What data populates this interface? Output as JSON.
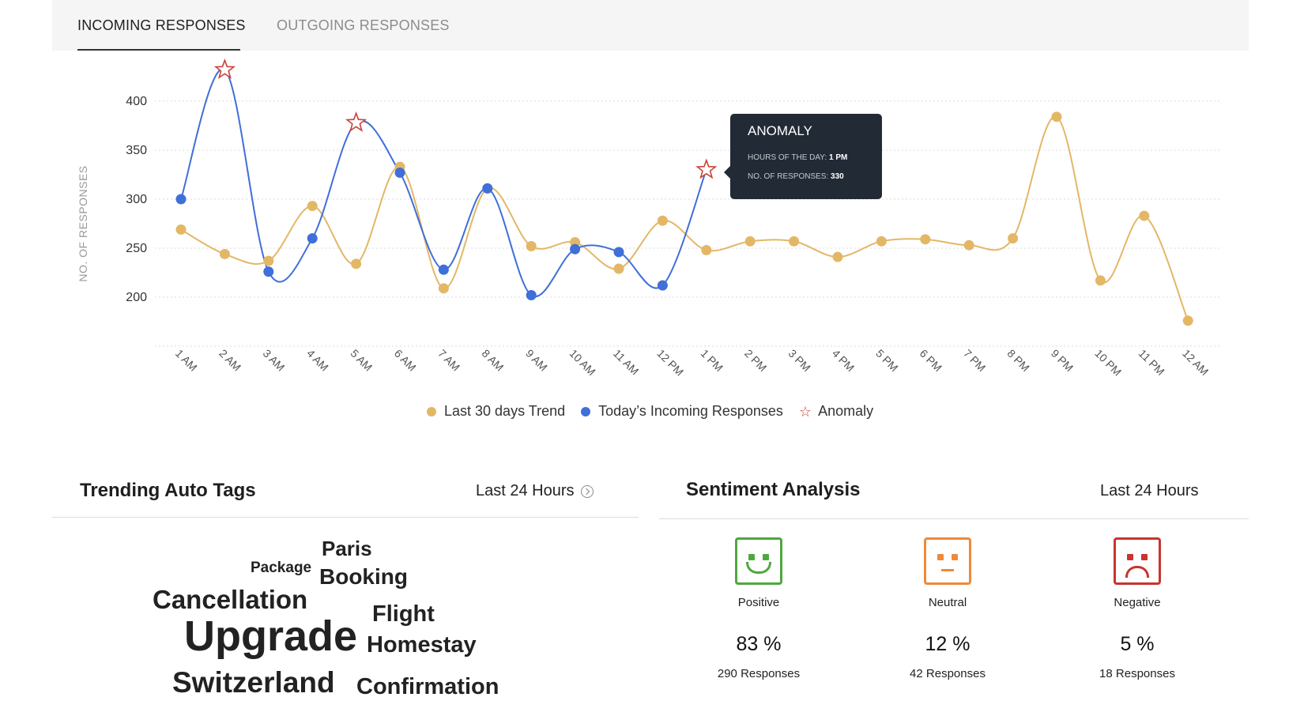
{
  "tabs": [
    {
      "label": "INCOMING RESPONSES",
      "active": true
    },
    {
      "label": "OUTGOING RESPONSES",
      "active": false
    }
  ],
  "chart_data": {
    "type": "line",
    "ylabel": "NO. OF RESPONSES",
    "ylim": [
      150,
      420
    ],
    "yticks": [
      200,
      250,
      300,
      350,
      400
    ],
    "categories": [
      "1 AM",
      "2 AM",
      "3 AM",
      "4 AM",
      "5 AM",
      "6 AM",
      "7 AM",
      "8 AM",
      "9 AM",
      "10 AM",
      "11 AM",
      "12 PM",
      "1 PM",
      "2 PM",
      "3 PM",
      "4 PM",
      "5 PM",
      "6 PM",
      "7 PM",
      "8 PM",
      "9 PM",
      "10 PM",
      "11 PM",
      "12 AM"
    ],
    "series": [
      {
        "name": "Last 30 days Trend",
        "color": "#e3b766",
        "values": [
          269,
          244,
          237,
          293,
          234,
          333,
          209,
          311,
          252,
          256,
          229,
          278,
          248,
          257,
          257,
          241,
          257,
          259,
          253,
          260,
          384,
          217,
          283,
          176
        ]
      },
      {
        "name": "Today’s Incoming Responses",
        "color": "#3f6fd8",
        "values": [
          300,
          432,
          226,
          260,
          378,
          327,
          228,
          311,
          202,
          249,
          246,
          212,
          330
        ]
      }
    ],
    "anomalies": [
      {
        "category": "2 AM",
        "value": 432
      },
      {
        "category": "5 AM",
        "value": 378
      },
      {
        "category": "1 PM",
        "value": 330
      }
    ],
    "anomaly_legend": "Anomaly",
    "tooltip": {
      "title": "ANOMALY",
      "hour_label": "HOURS OF THE DAY:",
      "hour_value": "1 PM",
      "count_label": "NO. OF RESPONSES:",
      "count_value": "330"
    },
    "grid": true,
    "legend_position": "bottom"
  },
  "tags_panel": {
    "title": "Trending Auto Tags",
    "period": "Last 24 Hours",
    "tags": [
      {
        "text": "Paris",
        "color": "#a8d07a"
      },
      {
        "text": "Package",
        "color": "#e06c8c"
      },
      {
        "text": "Booking",
        "color": "#a9b865"
      },
      {
        "text": "Cancellation",
        "color": "#79a7ee"
      },
      {
        "text": "Flight",
        "color": "#e0575a"
      },
      {
        "text": "Upgrade",
        "color": "#6fcfae"
      },
      {
        "text": "Homestay",
        "color": "#e89466"
      },
      {
        "text": "Switzerland",
        "color": "#a468dc"
      },
      {
        "text": "Confirmation",
        "color": "#ecc56a"
      }
    ]
  },
  "sentiment_panel": {
    "title": "Sentiment Analysis",
    "period": "Last 24 Hours",
    "items": [
      {
        "label": "Positive",
        "percent": "83 %",
        "count": "290 Responses",
        "color": "#4ea83f",
        "icon": "smiley-face-icon"
      },
      {
        "label": "Neutral",
        "percent": "12 %",
        "count": "42 Responses",
        "color": "#ee8a3a",
        "icon": "neutral-face-icon"
      },
      {
        "label": "Negative",
        "percent": "5 %",
        "count": "18 Responses",
        "color": "#c8342f",
        "icon": "sad-face-icon"
      }
    ]
  }
}
